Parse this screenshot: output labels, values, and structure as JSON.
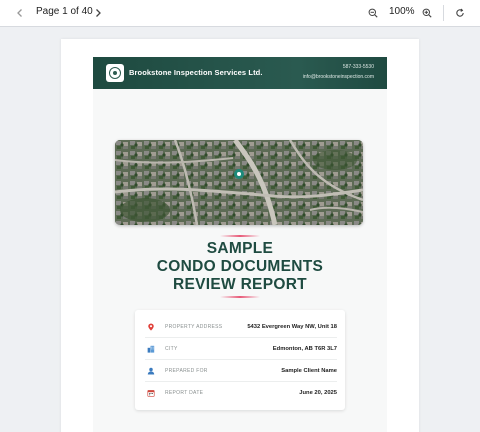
{
  "toolbar": {
    "page_label": "Page 1 of 40",
    "zoom_label": "100%"
  },
  "report": {
    "company_name": "Brookstone Inspection Services Ltd.",
    "company_phone": "587-333-5530",
    "company_email": "info@brookstoneinspection.com",
    "title_lines": [
      "SAMPLE",
      "CONDO DOCUMENTS",
      "REVIEW REPORT"
    ],
    "details": [
      {
        "label": "PROPERTY ADDRESS",
        "value": "5432 Evergreen Way NW, Unit 18",
        "icon": "map-pin-icon"
      },
      {
        "label": "CITY",
        "value": "Edmonton, AB T6R 3L7",
        "icon": "city-icon"
      },
      {
        "label": "PREPARED FOR",
        "value": "Sample Client Name",
        "icon": "user-icon"
      },
      {
        "label": "REPORT DATE",
        "value": "June 20, 2025",
        "icon": "calendar-icon"
      }
    ]
  },
  "colors": {
    "brand_dark_green": "#1f4b41",
    "accent_pink": "#e85a78",
    "pin_red": "#e0403a"
  }
}
